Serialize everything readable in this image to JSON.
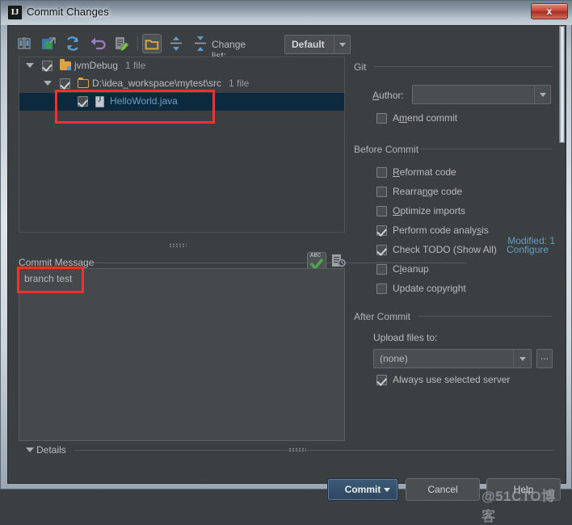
{
  "window": {
    "title": "Commit Changes",
    "app_icon": "intellij-idea-icon",
    "close_label": "x"
  },
  "toolbar": {
    "buttons": [
      {
        "name": "show-diff-icon",
        "tooltip": "Show Diff"
      },
      {
        "name": "revert-changes-icon",
        "tooltip": "Revert"
      },
      {
        "name": "refresh-icon",
        "tooltip": "Refresh"
      },
      {
        "name": "rollback-icon",
        "tooltip": "Rollback"
      },
      {
        "name": "edit-source-icon",
        "tooltip": "Edit Source"
      },
      {
        "name": "group-by-directory-icon",
        "tooltip": "Group By Directory",
        "active": true
      },
      {
        "name": "expand-all-icon",
        "tooltip": "Expand All"
      },
      {
        "name": "collapse-all-icon",
        "tooltip": "Collapse All"
      }
    ],
    "changelist_label": "Change lis",
    "changelist_label_underlined": "t",
    "changelist_label_colon": ":",
    "changelist_value": "Default"
  },
  "file_tree": {
    "rows": [
      {
        "indent": 0,
        "label": "jvmDebug",
        "count": "1 file",
        "checked": true,
        "expanded": true,
        "icon": "module-folder-icon",
        "selected": false
      },
      {
        "indent": 1,
        "label": "D:\\idea_workspace\\mytest\\src",
        "count": "1 file",
        "checked": true,
        "expanded": true,
        "icon": "folder-icon",
        "selected": false
      },
      {
        "indent": 2,
        "label": "HelloWorld.java",
        "count": "",
        "checked": true,
        "expanded": null,
        "icon": "java-file-icon",
        "selected": true
      }
    ],
    "modified_status": "Modified: 1"
  },
  "commit_message": {
    "label": "ommit Message",
    "label_mnemonic": "C",
    "value": "branch test",
    "spellcheck_icon": "spellcheck-abc-icon",
    "spellcheck_text": "ABC",
    "history_icon": "message-history-icon"
  },
  "git_section": {
    "title": "Git",
    "author_label_mnemonic": "A",
    "author_label": "uthor:",
    "author_value": "",
    "amend_commit": {
      "label_pre": "A",
      "label_mnemonic": "m",
      "label_post": "end commit",
      "checked": false
    }
  },
  "before_commit": {
    "title": "Before Commit",
    "items": [
      {
        "pre": "",
        "mnemonic": "R",
        "post": "eformat code",
        "checked": false
      },
      {
        "pre": "Rearra",
        "mnemonic": "n",
        "post": "ge code",
        "checked": false
      },
      {
        "pre": "",
        "mnemonic": "O",
        "post": "ptimize imports",
        "checked": false
      },
      {
        "pre": "Perform code analy",
        "mnemonic": "s",
        "post": "is",
        "checked": true
      },
      {
        "pre": "Check TODO (Show All)",
        "mnemonic": "",
        "post": "",
        "checked": true,
        "link": "Configure"
      },
      {
        "pre": "C",
        "mnemonic": "l",
        "post": "eanup",
        "checked": false
      },
      {
        "pre": "Update copyright",
        "mnemonic": "",
        "post": "",
        "checked": false
      }
    ]
  },
  "after_commit": {
    "title": "After Commit",
    "upload_label": "Upload files to:",
    "upload_value": "(none)",
    "upload_browse_label": "...",
    "always_use_server": {
      "label": "Always use selected server",
      "checked": true
    }
  },
  "details": {
    "label": "Details",
    "expanded": false
  },
  "footer": {
    "commit_label": "Commit",
    "commit_mnemonic": "t",
    "cancel_label": "Cancel",
    "help_label": "Help"
  },
  "watermark": "@51CTO博客",
  "colors": {
    "panel_bg": "#3c3f41",
    "selection_blue": "#0d293e",
    "link_blue": "#5f9ec7",
    "annotation_red": "#fc2e2e",
    "commit_button": "#2d4661",
    "folder_yellow": "#d9a441"
  }
}
